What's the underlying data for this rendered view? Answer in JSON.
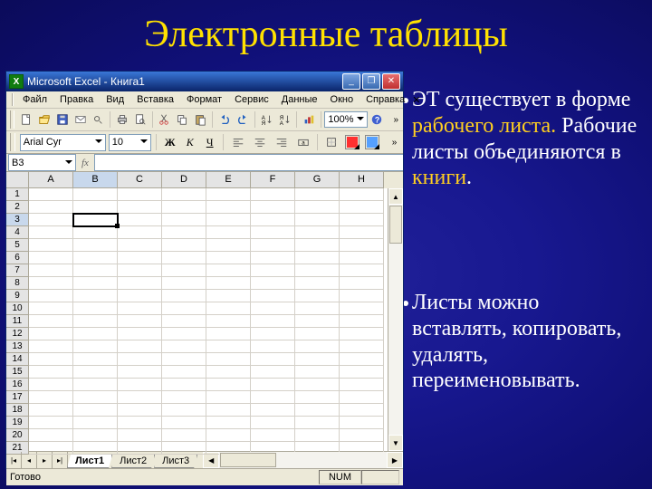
{
  "title": "Электронные таблицы",
  "bullets": {
    "p1_a": "ЭТ существует в форме ",
    "p1_h1": "рабочего листа.",
    "p1_b": " Рабочие листы объединяются в ",
    "p1_h2": "книги",
    "p1_c": ".",
    "p2": "Листы можно вставлять, копировать, удалять, переименовывать."
  },
  "excel": {
    "icon": "X",
    "title": "Microsoft Excel - Книга1",
    "menu": [
      "Файл",
      "Правка",
      "Вид",
      "Вставка",
      "Формат",
      "Сервис",
      "Данные",
      "Окно",
      "Справка"
    ],
    "zoom": "100%",
    "font": "Arial Cyr",
    "fontsize": "10",
    "bold": "Ж",
    "italic": "К",
    "underline": "Ч",
    "namebox": "B3",
    "fx": "fx",
    "cols": [
      "A",
      "B",
      "C",
      "D",
      "E",
      "F",
      "G",
      "H"
    ],
    "rows": [
      "1",
      "2",
      "3",
      "4",
      "5",
      "6",
      "7",
      "8",
      "9",
      "10",
      "11",
      "12",
      "13",
      "14",
      "15",
      "16",
      "17",
      "18",
      "19",
      "20",
      "21"
    ],
    "activeCol": 1,
    "activeRow": 2,
    "tabs": [
      "Лист1",
      "Лист2",
      "Лист3"
    ],
    "activeTab": 0,
    "status_ready": "Готово",
    "status_num": "NUM"
  }
}
